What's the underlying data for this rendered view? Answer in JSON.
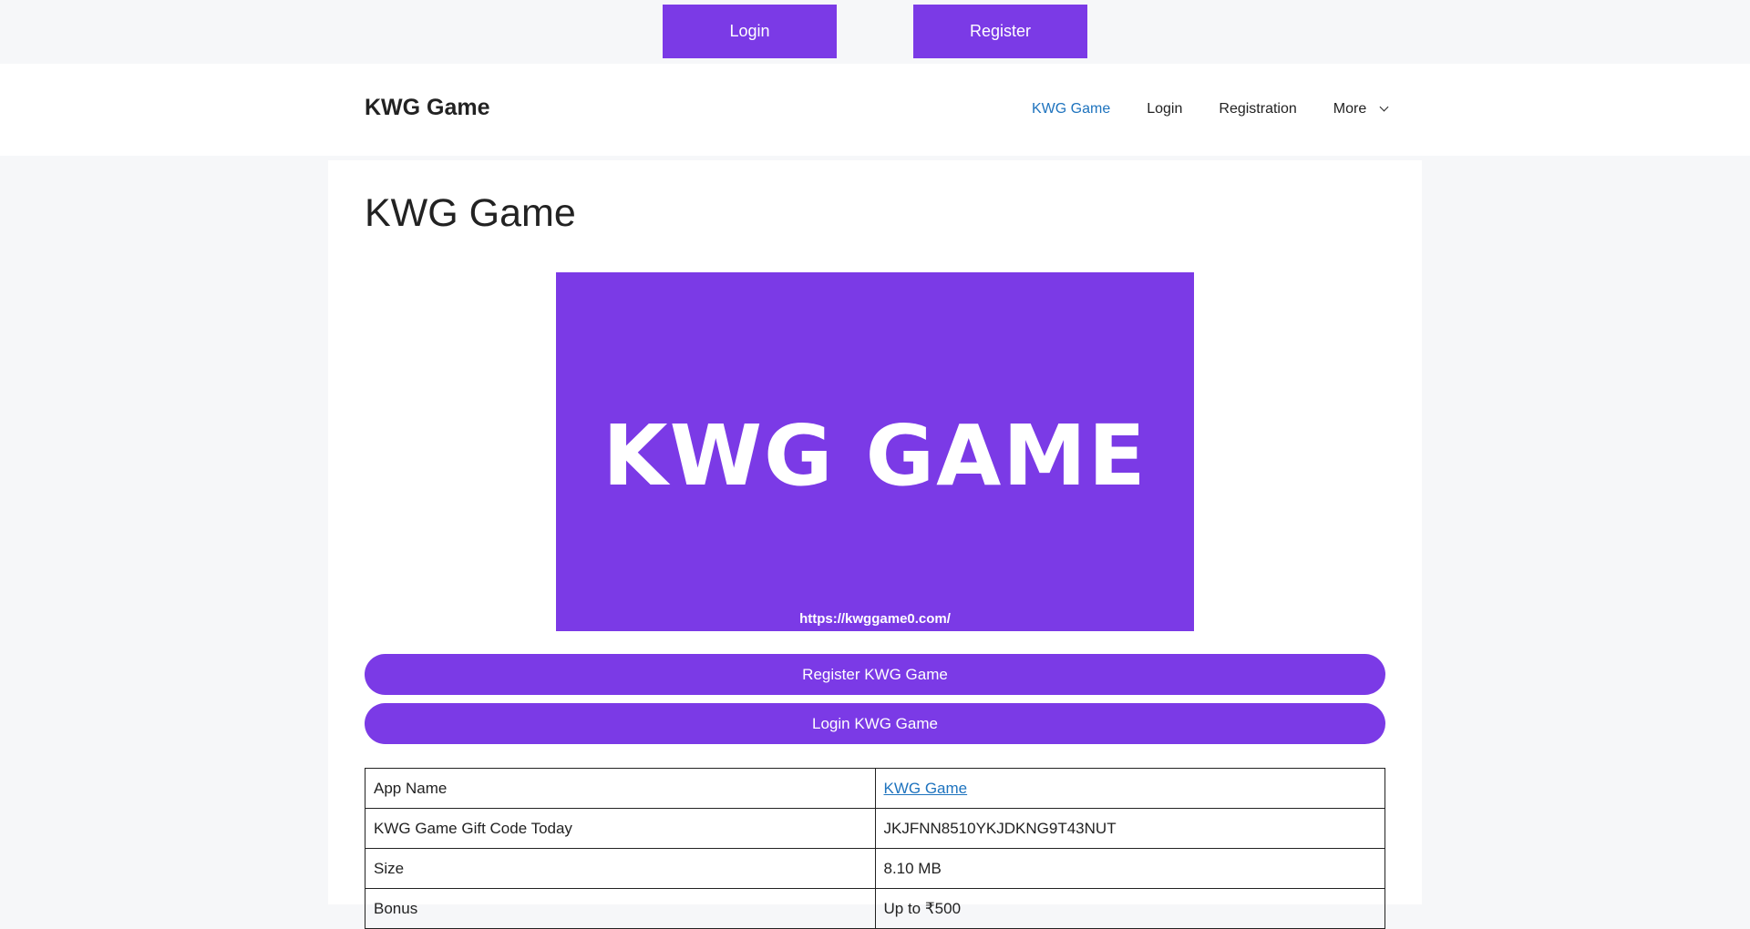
{
  "topbar": {
    "login_label": "Login",
    "register_label": "Register"
  },
  "header": {
    "site_title": "KWG Game",
    "nav": [
      {
        "label": "KWG Game"
      },
      {
        "label": "Login"
      },
      {
        "label": "Registration"
      },
      {
        "label": "More"
      }
    ]
  },
  "main": {
    "title": "KWG Game",
    "banner": {
      "text": "KWG GAME",
      "url": "https://kwggame0.com/"
    },
    "register_button": "Register KWG Game",
    "login_button": "Login KWG Game",
    "table": [
      {
        "key": "App Name",
        "value": "KWG Game"
      },
      {
        "key": "KWG Game Gift Code Today",
        "value": "JKJFNN8510YKJDKNG9T43NUT"
      },
      {
        "key": "Size",
        "value": "8.10 MB"
      },
      {
        "key": "Bonus",
        "value": "Up to ₹500"
      }
    ]
  },
  "colors": {
    "accent": "#7b3ae6",
    "link": "#1e73be",
    "background": "#f6f7f9"
  }
}
